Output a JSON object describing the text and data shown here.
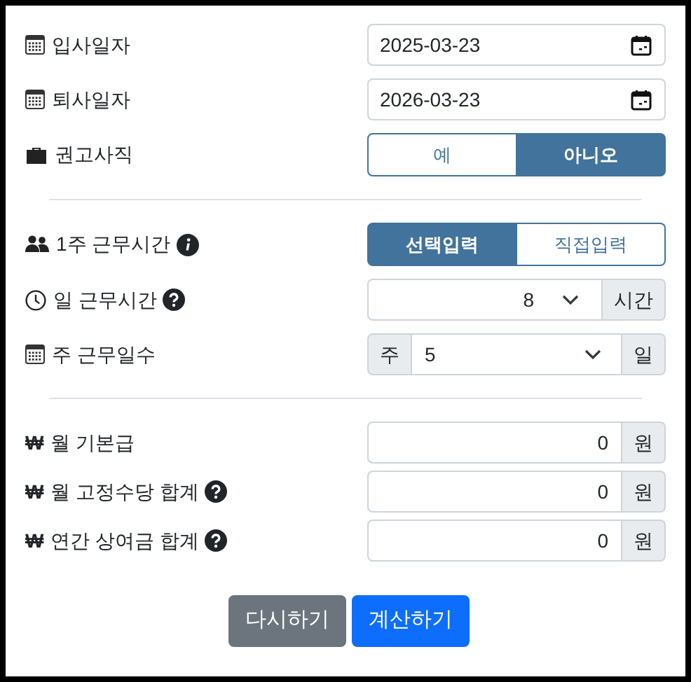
{
  "sections": [
    [
      {
        "kind": "date",
        "label": "입사일자",
        "value": "2025-03-23"
      },
      {
        "kind": "date",
        "label": "퇴사일자",
        "value": "2026-03-23"
      },
      {
        "kind": "yesno",
        "label": "권고사직",
        "options": [
          {
            "label": "예",
            "selected": false
          },
          {
            "label": "아니오",
            "selected": true
          }
        ]
      }
    ],
    [
      {
        "kind": "mode",
        "label": "1주 근무시간",
        "hint": {
          "kind": "info"
        },
        "options": [
          {
            "label": "선택입력",
            "selected": true
          },
          {
            "label": "직접입력",
            "selected": false
          }
        ]
      },
      {
        "kind": "hours",
        "label": "일 근무시간",
        "hint": {
          "kind": "question"
        },
        "value": "8",
        "suffix": "시간"
      },
      {
        "kind": "days",
        "label": "주 근무일수",
        "prefix": "주",
        "value": "5",
        "suffix": "일"
      }
    ],
    [
      {
        "kind": "money",
        "sign": "₩",
        "label": "월 기본급",
        "value": "0",
        "suffix": "원"
      },
      {
        "kind": "money",
        "sign": "₩",
        "label": "월 고정수당 합계",
        "hint": {
          "kind": "question"
        },
        "value": "0",
        "suffix": "원"
      },
      {
        "kind": "money",
        "sign": "₩",
        "label": "연간 상여금 합계",
        "hint": {
          "kind": "question"
        },
        "value": "0",
        "suffix": "원"
      }
    ]
  ],
  "buttons": [
    {
      "kind": "reset",
      "label": "다시하기"
    },
    {
      "kind": "submit",
      "label": "계산하기"
    }
  ]
}
